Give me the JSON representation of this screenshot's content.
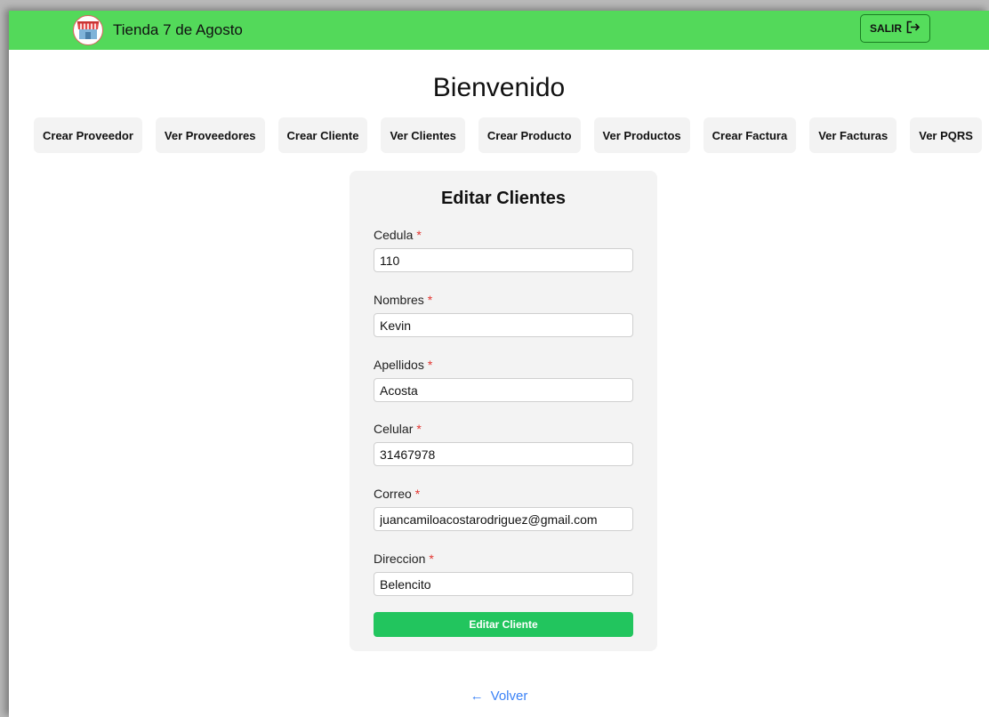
{
  "header": {
    "brand_name": "Tienda 7 de Agosto",
    "logo_icon": "store-awning-icon",
    "logout_label": "SALIR",
    "logout_icon": "logout-arrow-icon",
    "background_color": "#53d95a"
  },
  "page": {
    "welcome_title": "Bienvenido"
  },
  "menu": {
    "items": [
      {
        "label": "Crear Proveedor"
      },
      {
        "label": "Ver Proveedores"
      },
      {
        "label": "Crear Cliente"
      },
      {
        "label": "Ver Clientes"
      },
      {
        "label": "Crear Producto"
      },
      {
        "label": "Ver Productos"
      },
      {
        "label": "Crear Factura"
      },
      {
        "label": "Ver Facturas"
      },
      {
        "label": "Ver PQRS"
      }
    ]
  },
  "form": {
    "title": "Editar Clientes",
    "required_marker": "*",
    "fields": [
      {
        "label": "Cedula",
        "value": "110"
      },
      {
        "label": "Nombres",
        "value": "Kevin"
      },
      {
        "label": "Apellidos",
        "value": "Acosta"
      },
      {
        "label": "Celular",
        "value": "31467978"
      },
      {
        "label": "Correo",
        "value": "juancamiloacostarodriguez@gmail.com"
      },
      {
        "label": "Direccion",
        "value": "Belencito"
      }
    ],
    "submit_label": "Editar Cliente",
    "submit_color": "#22c55e"
  },
  "footer": {
    "back_arrow": "←",
    "back_label": "Volver",
    "link_color": "#3b82f6"
  }
}
